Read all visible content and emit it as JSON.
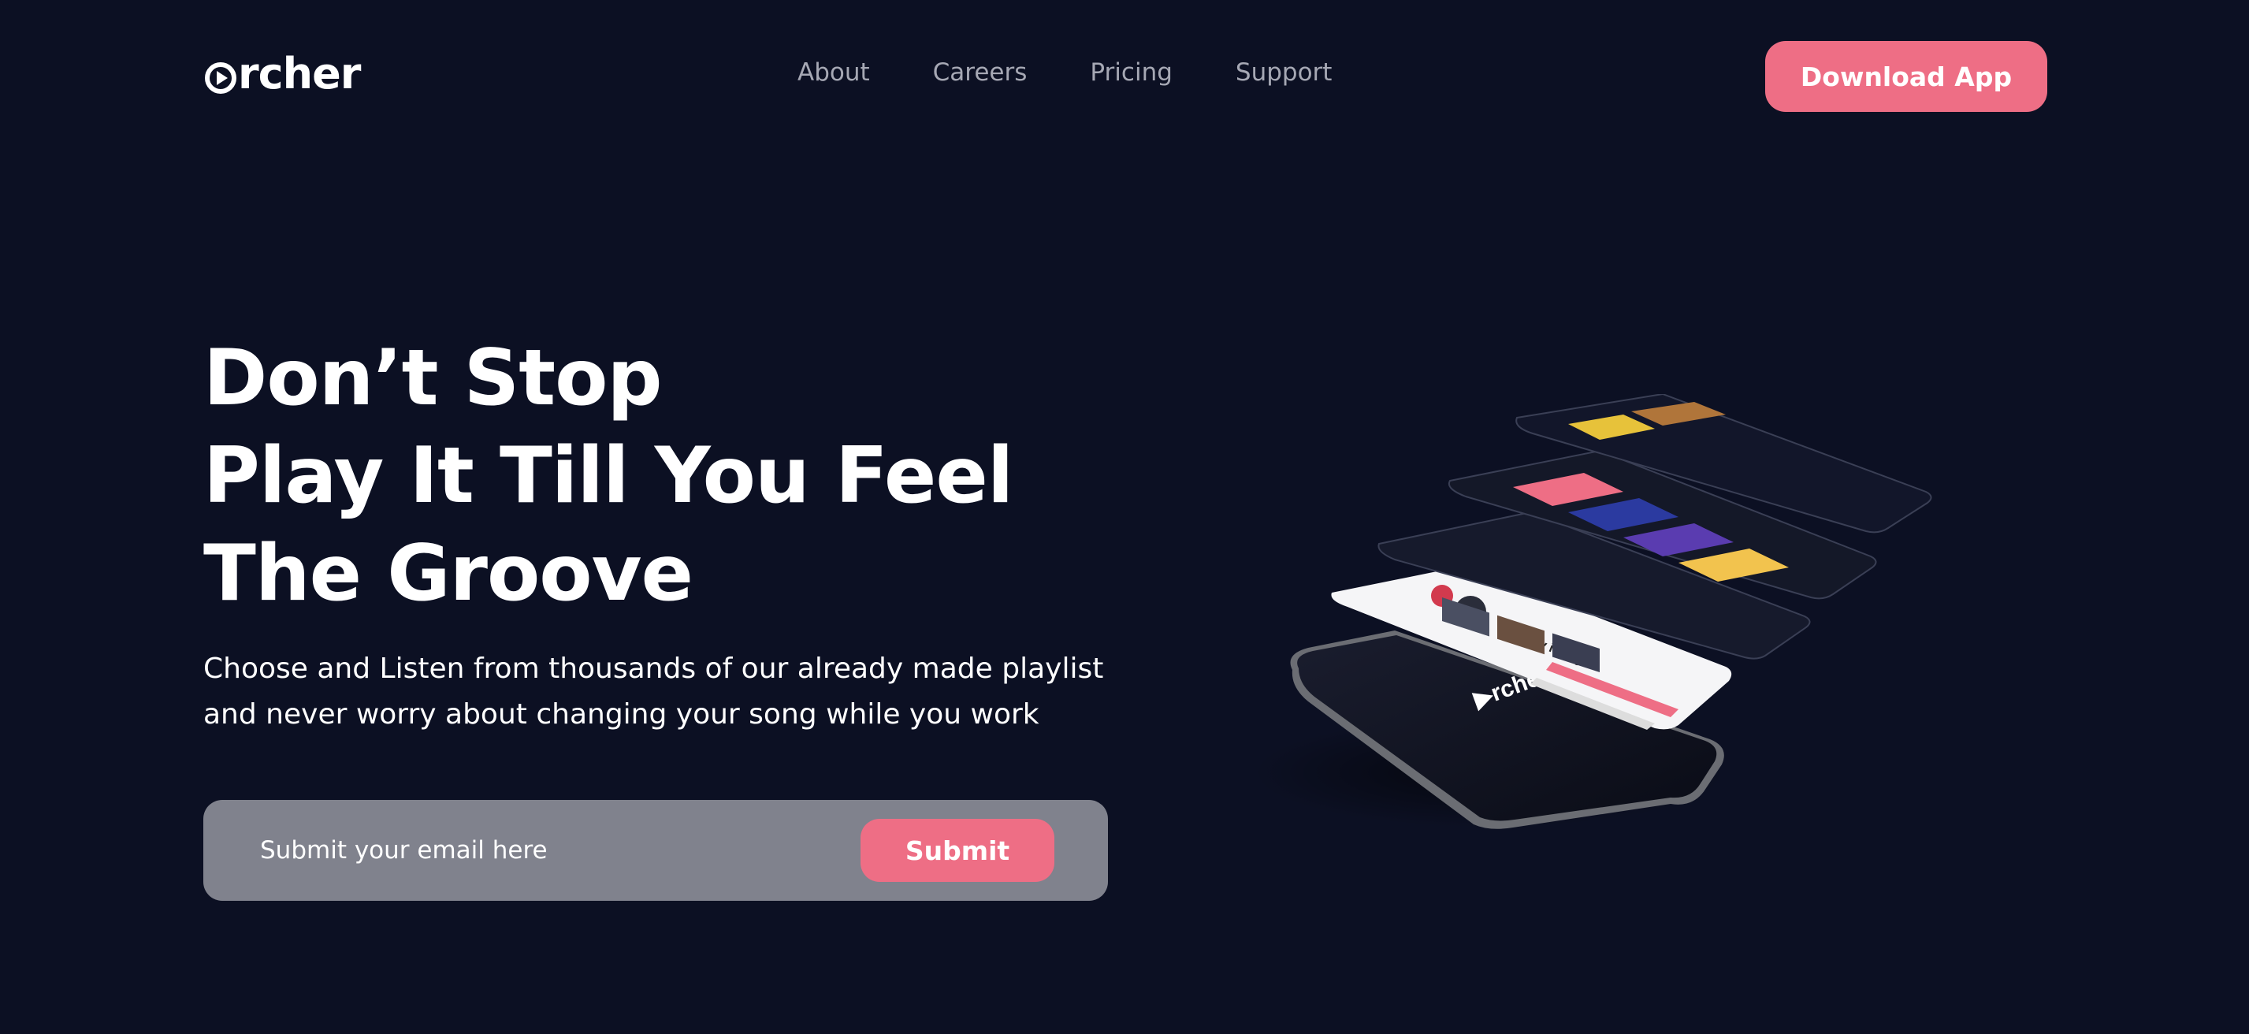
{
  "brand": {
    "name": "rcher",
    "logo_icon": "play-circle-icon"
  },
  "nav": {
    "items": [
      {
        "label": "About"
      },
      {
        "label": "Careers"
      },
      {
        "label": "Pricing"
      },
      {
        "label": "Support"
      }
    ],
    "cta_label": "Download App"
  },
  "hero": {
    "headline_lines": [
      "Don’t Stop",
      "Play It Till You Feel",
      "The Groove"
    ],
    "subtext_lines": [
      "Choose and Listen from thousands of our already made playlist",
      "and never worry about changing your song while you work"
    ],
    "email_placeholder": "Submit your email here",
    "submit_label": "Submit",
    "illustration": "stacked-phone-screens-mockup"
  },
  "colors": {
    "background": "#0c1023",
    "accent": "#ee6e85",
    "nav_text": "#a6a8b4",
    "form_background": "#80828d"
  }
}
